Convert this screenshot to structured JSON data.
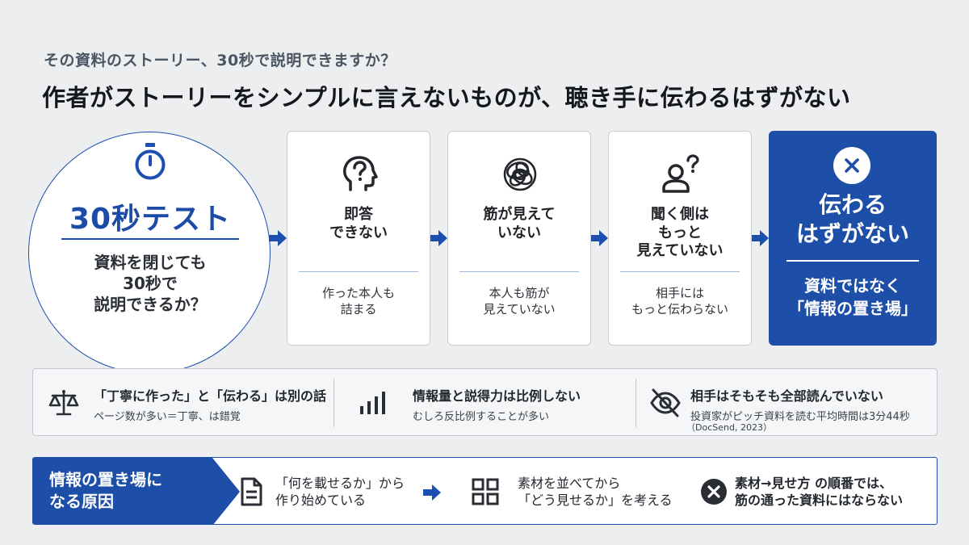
{
  "header": {
    "subtitle": "その資料のストーリー、30秒で説明できますか？",
    "title": "作者がストーリーをシンプルに言えないものが、聴き手に伝わるはずがない"
  },
  "test": {
    "icon": "stopwatch-icon",
    "title": "30秒テスト",
    "lines": [
      "資料を閉じても",
      "30秒で",
      "説明できるか？"
    ]
  },
  "cards": [
    {
      "icon": "head-question-icon",
      "title": [
        "即答",
        "できない"
      ],
      "body": [
        "作った本人も",
        "詰まる"
      ]
    },
    {
      "icon": "tangled-scribble-icon",
      "title": [
        "筋が見えて",
        "いない"
      ],
      "body": [
        "本人も筋が",
        "見えていない"
      ]
    },
    {
      "icon": "person-question-icon",
      "title": [
        "聞く側は",
        "もっと",
        "見えていない"
      ],
      "body": [
        "相手には",
        "もっと伝わらない"
      ]
    }
  ],
  "result": {
    "icon": "x-icon",
    "title": [
      "伝わる",
      "はずがない"
    ],
    "body": [
      "資料ではなく",
      "「情報の置き場」"
    ]
  },
  "facts": [
    {
      "icon": "scale-icon",
      "title": "「丁寧に作った」と「伝わる」は別の話",
      "sub": "ページ数が多い＝丁寧、は錯覚"
    },
    {
      "icon": "bar-chart-icon",
      "title": "情報量と説得力は比例しない",
      "sub": "むしろ反比例することが多い"
    },
    {
      "icon": "eye-off-icon",
      "title": "相手はそもそも全部読んでいない",
      "sub": "投資家がピッチ資料を読む平均時間は3分44秒",
      "sub2": "（DocSend, 2023）"
    }
  ],
  "cause": {
    "label": [
      "情報の置き場に",
      "なる原因"
    ],
    "steps": [
      {
        "icon": "document-icon",
        "text": [
          "「何を載せるか」から",
          "作り始めている"
        ]
      },
      {
        "icon": "grid-icon",
        "text": [
          "素材を並べてから",
          "「どう見せるか」を考える"
        ]
      },
      {
        "icon": "x-circle-icon",
        "text": [
          "素材→見せ方 の順番では、",
          "筋の通った資料にはならない"
        ]
      }
    ]
  },
  "colors": {
    "accent": "#1e4fa8",
    "background": "#eceeef",
    "card": "#ffffff",
    "dark_icon": "#2a2d33"
  }
}
